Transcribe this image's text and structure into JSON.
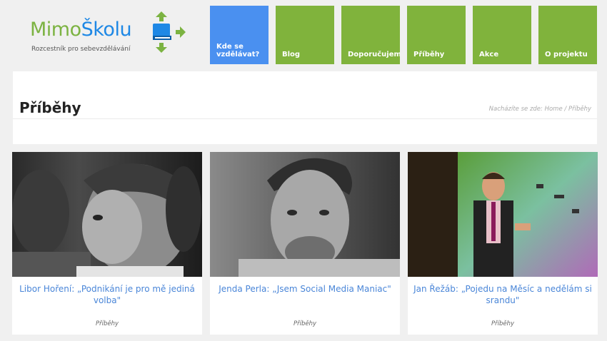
{
  "logo": {
    "name_part1": "Mimo",
    "name_part2": "Školu",
    "tagline": "Rozcestník pro sebevzdělávání",
    "colors": {
      "green": "#7cb342",
      "blue": "#1e88e5"
    }
  },
  "nav": [
    {
      "label": "Kde se vzdělávat?",
      "active": true
    },
    {
      "label": "Blog",
      "active": false
    },
    {
      "label": "Doporučujeme",
      "active": false
    },
    {
      "label": "Příběhy",
      "active": false
    },
    {
      "label": "Akce",
      "active": false
    },
    {
      "label": "O projektu",
      "active": false
    }
  ],
  "page": {
    "title": "Příběhy",
    "breadcrumb": "Nacházíte se zde: Home / Příběhy"
  },
  "cards": [
    {
      "title": "Libor Hoření: „Podnikání je pro mě jediná volba\"",
      "category": "Příběhy"
    },
    {
      "title": "Jenda Perla: „Jsem Social Media Maniac\"",
      "category": "Příběhy"
    },
    {
      "title": "Jan Řežáb: „Pojedu na Měsíc a nedělám si srandu\"",
      "category": "Příběhy"
    }
  ],
  "colors": {
    "nav_green": "#80b33c",
    "nav_active_blue": "#4a90f0",
    "link_blue": "#4a86d8"
  }
}
